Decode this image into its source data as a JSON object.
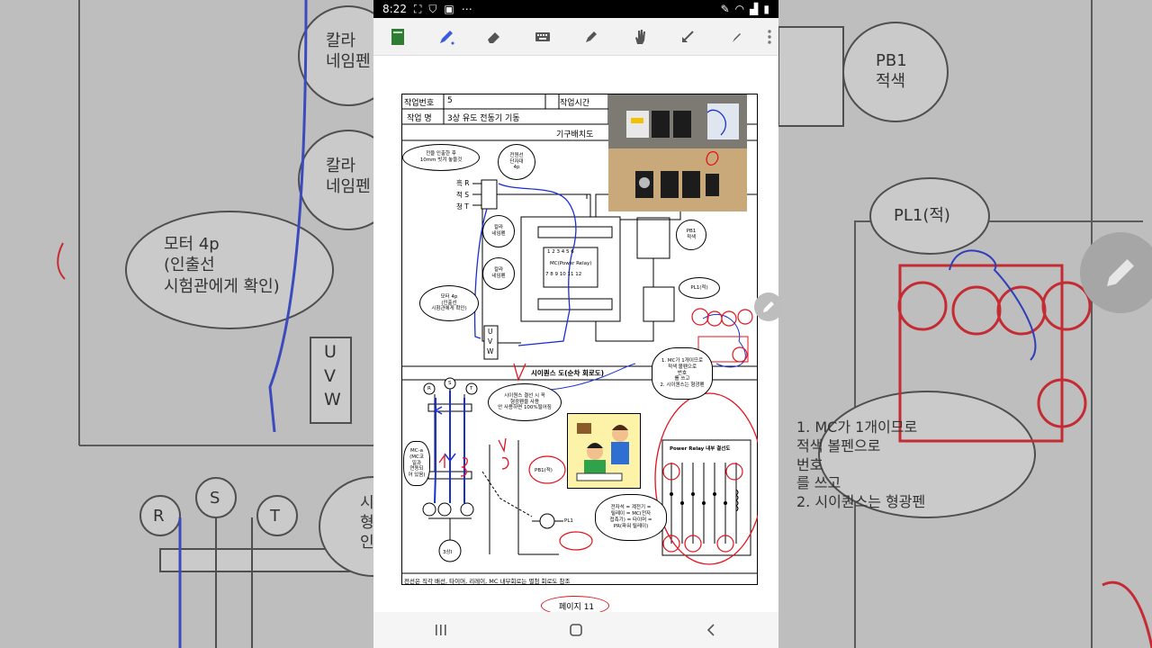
{
  "status": {
    "time": "8:22",
    "dots": "⋯"
  },
  "toolbar": {
    "tools": [
      "notebook-icon",
      "pen-icon",
      "eraser-icon",
      "keyboard-icon",
      "highlighter-icon",
      "hand-icon",
      "arrow-icon",
      "pen-small-icon",
      "more-icon"
    ]
  },
  "document": {
    "task_number_label": "작업번호",
    "task_number_value": "5",
    "task_time_label": "작업시간",
    "task_name_label": "작업 명",
    "task_name_value": "3상 유도 전동기 기동",
    "layout_label": "기구배치도",
    "phases": [
      "흑 R",
      "적 S",
      "청 T"
    ],
    "bubbles": {
      "wire_note": "전을 인출한 후\n10mm 빗겨 놓을것",
      "power_terminal": "전원선\n단자대\n4p",
      "color_pen_1": "칼라\n네임펜",
      "color_pen_2": "칼라\n네임펜",
      "motor_note": "모터 4p\n(인출선\n시험관에게 확인)",
      "pb1": "PB1\n적색",
      "pl1": "PL1(적)",
      "mc_note": "1. MC가 1개이므로\n적색 볼펜으로\n번호\n를 쓰고\n2. 시이퀀스는 형광펜",
      "sequence_note": "시이퀀스 결선 시 꼭\n형광펜을 사용\n안 사용하면 100%떨어짐",
      "mc_a": "MC-a\n(MC코\n일과\n연동되\n어 있음)",
      "connector_note": "전자석 = 계전기 =\n릴레이 = MC(전자\n접촉기) = 타이머 =\nPR(파워 릴레이)"
    },
    "relay_label_top": "1 2 3 4 5 6",
    "relay_label_mid": "MC(Power Relay)",
    "relay_label_bot": "7 8 9 10 11 12",
    "uvw": [
      "U",
      "V",
      "W"
    ],
    "sequence_title": "시이퀀스 도(순차 회로도)",
    "rst": [
      "R",
      "S",
      "T"
    ],
    "motor": "3상I",
    "pb1_label": "PB1(적)",
    "pl1_label": "PL1",
    "power_relay_label": "Power Relay 내부 결선도",
    "footer_note": "전선은 직각 배선, 타이머, 리레이, MC 내부회로는 별첨 회로도 참조",
    "page": "페이지 11"
  },
  "background": {
    "left_texts": [
      "칼라\n네임펜",
      "칼라\n네임펜",
      "모터 4p\n(인출선\n시험관에게 확인)",
      "U\nV\nW",
      "R",
      "S",
      "T",
      "시\n형\n인"
    ],
    "right_texts": [
      "PB1\n적색",
      "PL1(적)",
      "1. MC가 1개이므로\n    적색 볼펜으로\n번호\n    를 쓰고\n2. 시이퀀스는 형광펜"
    ]
  },
  "colors": {
    "ink_blue": "#1a2fd1",
    "ink_red": "#e0141e",
    "toolbar_accent": "#3b5bdb",
    "notebook_green": "#2e7d32"
  }
}
